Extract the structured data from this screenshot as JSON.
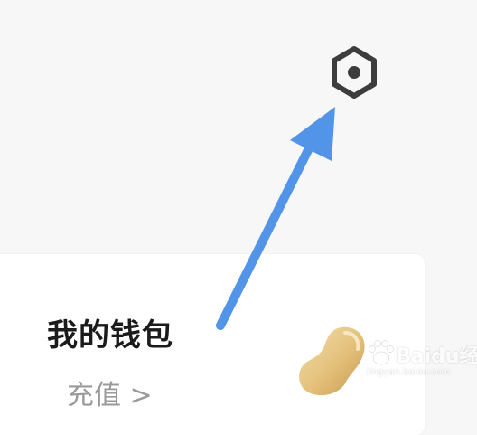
{
  "header": {
    "settings_icon": "hexagon-settings-icon",
    "icon_color": "#3d3d3d"
  },
  "wallet_card": {
    "title": "我的钱包",
    "subtitle": "充值 >",
    "bean_icon": "bean-icon"
  },
  "annotation": {
    "arrow_icon": "arrow-icon",
    "arrow_color": "#5194e8"
  },
  "watermark": {
    "brand": "Baidu经验",
    "url": "jingyan.baidu.com"
  }
}
